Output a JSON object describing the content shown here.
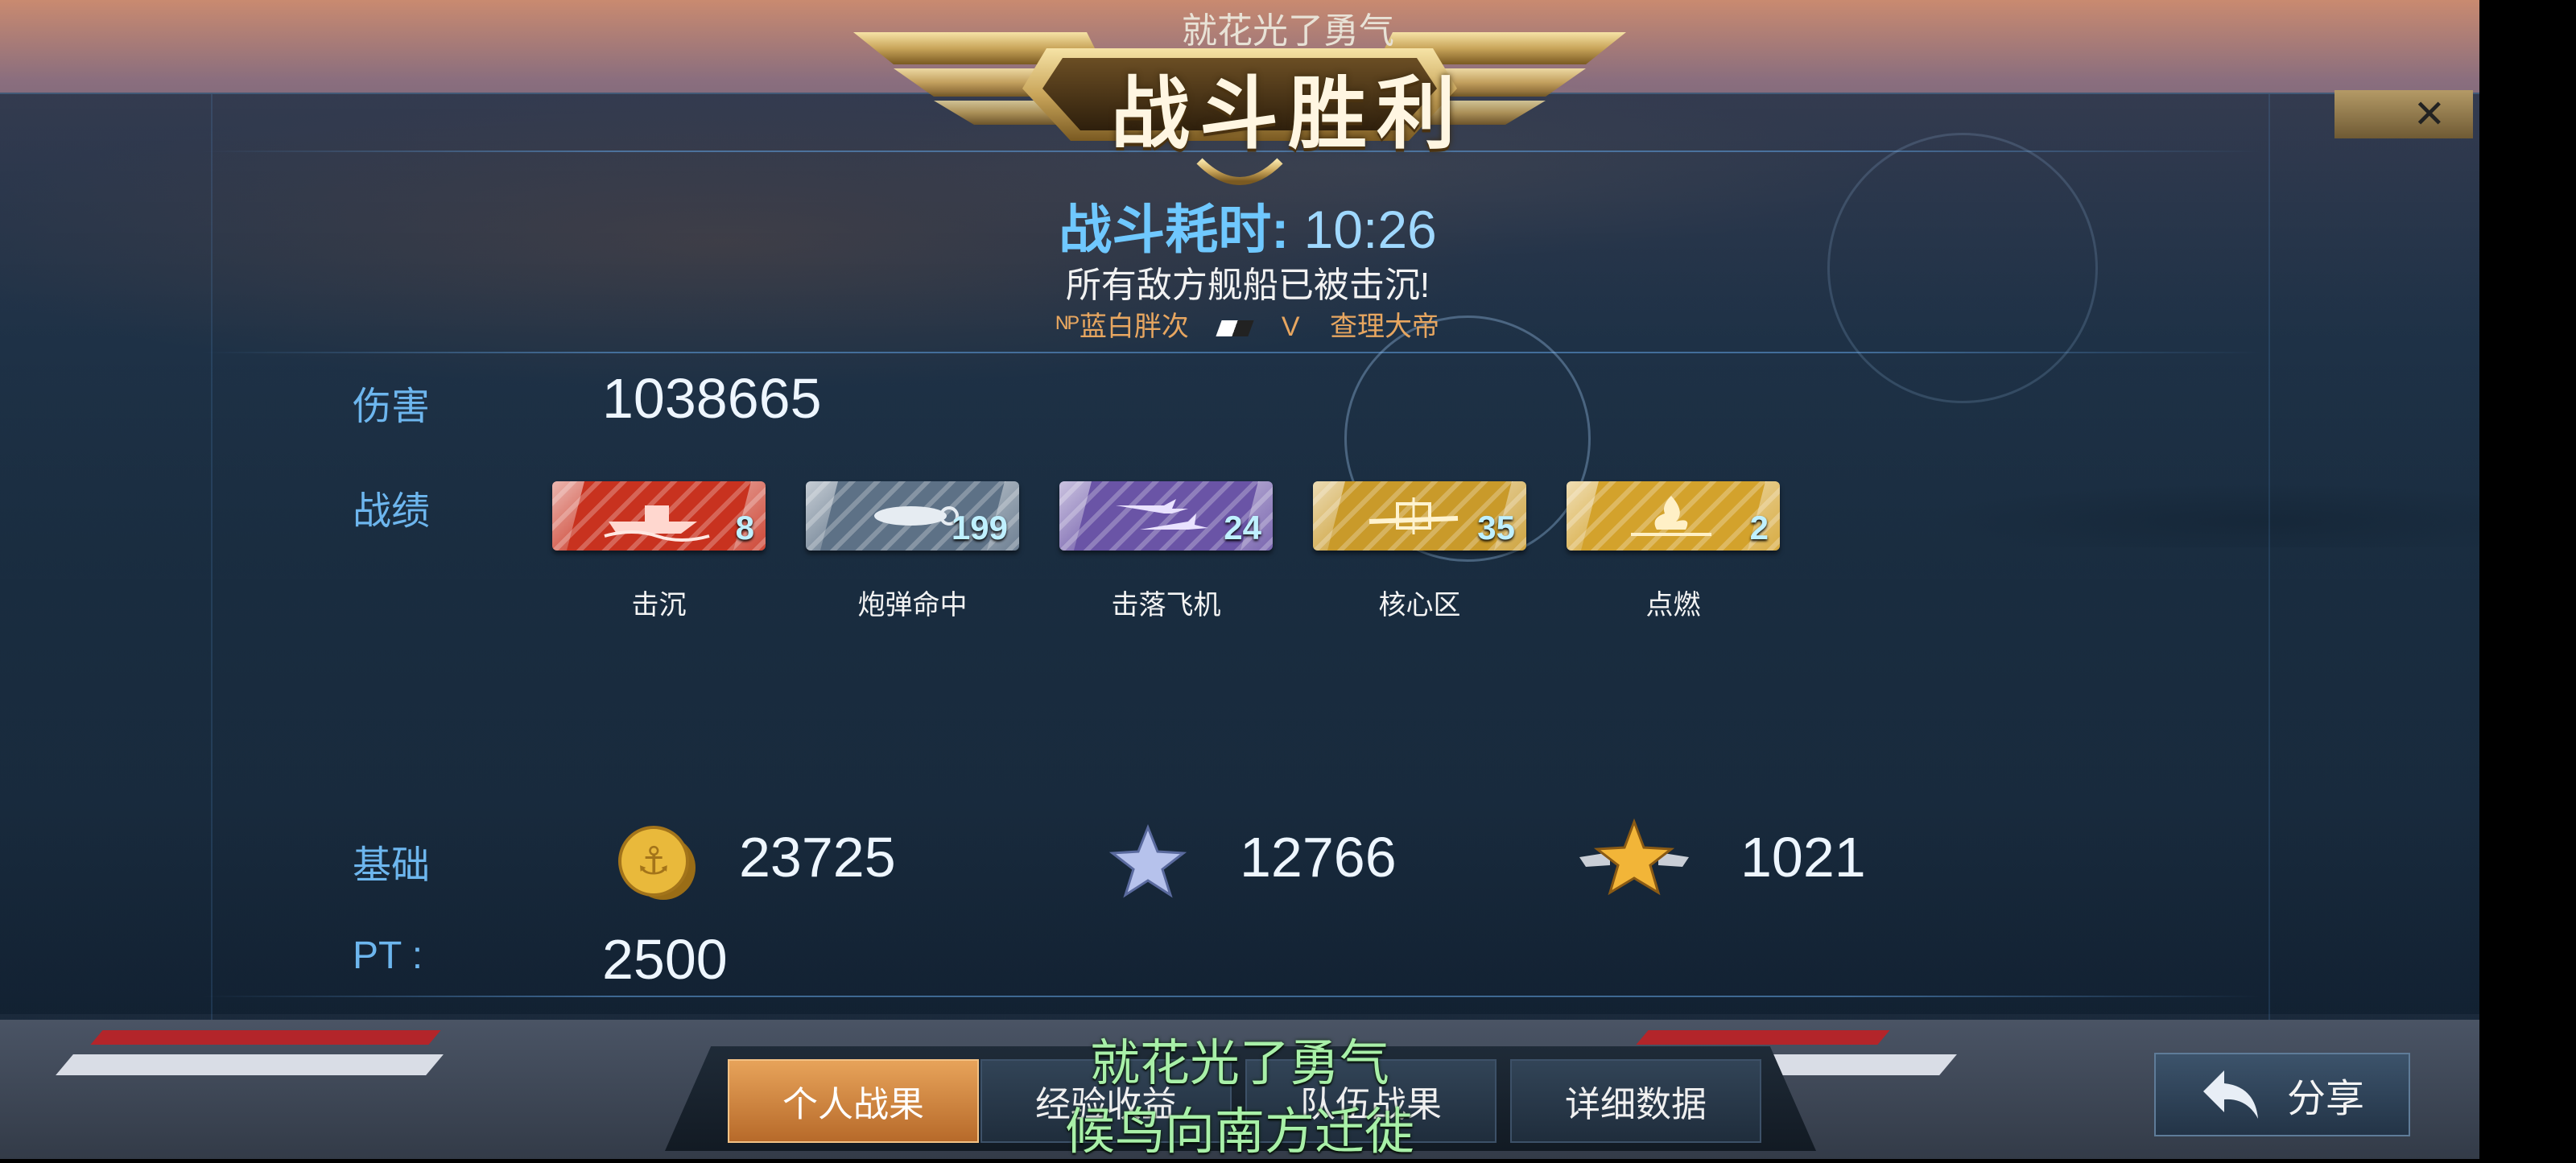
{
  "header": {
    "top_caption": "就花光了勇气",
    "title": "战斗胜利",
    "close_label": "✕"
  },
  "summary": {
    "duration_label": "战斗耗时:",
    "duration_value": "10:26",
    "result_text": "所有敌方舰船已被击沉!",
    "player_left": "ᴺᴾ蓝白胖次",
    "versus": "V",
    "player_right": "查理大帝"
  },
  "stats": {
    "damage_label": "伤害",
    "damage_value": "1038665",
    "record_label": "战绩",
    "medals": [
      {
        "label": "击沉",
        "count": "8",
        "color": "#c8321f",
        "icon": "ship-sink-icon"
      },
      {
        "label": "炮弹命中",
        "count": "199",
        "color": "#5d7186",
        "icon": "shell-hit-icon"
      },
      {
        "label": "击落飞机",
        "count": "24",
        "color": "#6a54a6",
        "icon": "plane-down-icon"
      },
      {
        "label": "核心区",
        "count": "35",
        "color": "#c99a2a",
        "icon": "citadel-icon"
      },
      {
        "label": "点燃",
        "count": "2",
        "color": "#d3a22c",
        "icon": "fire-icon"
      }
    ]
  },
  "rewards": {
    "base_label": "基础",
    "coins": "23725",
    "exp": "12766",
    "commander_exp": "1021",
    "pt_label": "PT :",
    "pt_value": "2500"
  },
  "tabs": [
    {
      "label": "个人战果",
      "active": true
    },
    {
      "label": "经验收益",
      "active": false
    },
    {
      "label": "队伍战果",
      "active": false
    },
    {
      "label": "详细数据",
      "active": false
    }
  ],
  "share": {
    "label": "分享"
  },
  "lyrics": {
    "line1": "就花光了勇气",
    "line2": "候鸟向南方迁徙"
  },
  "colors": {
    "accent_blue": "#6db6ee",
    "tab_active": "#e7a35a",
    "lyrics_green": "#a8f0a8"
  }
}
